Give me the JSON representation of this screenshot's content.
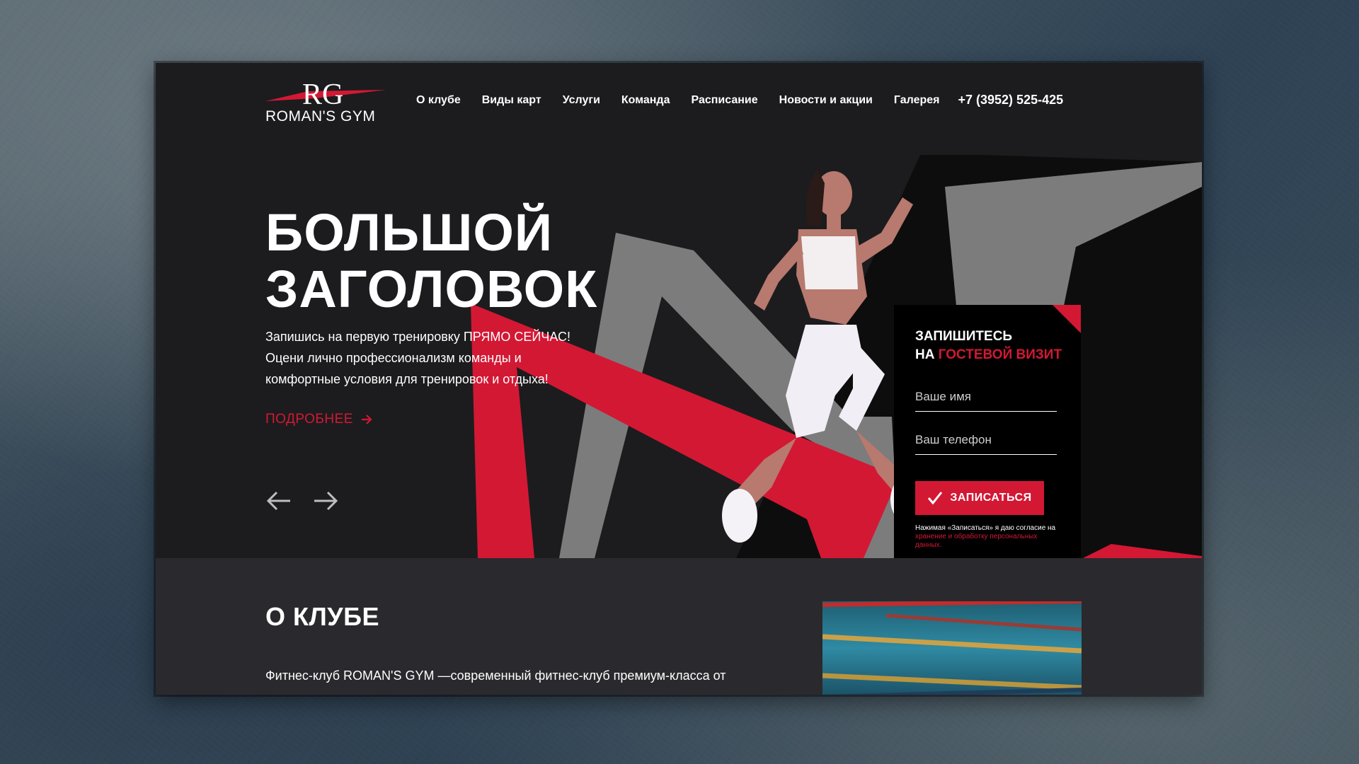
{
  "brand": {
    "logo_text": "ROMAN'S GYM"
  },
  "nav": {
    "items": [
      "О клубе",
      "Виды карт",
      "Услуги",
      "Команда",
      "Расписание",
      "Новости и акции",
      "Галерея"
    ],
    "phone": "+7 (3952) 525-425"
  },
  "hero": {
    "headline_line1": "БОЛЬШОЙ",
    "headline_line2": "ЗАГОЛОВОК",
    "lead": "Запишись на первую тренировку ПРЯМО СЕЙЧАС! Оцени лично профессионализм команды и комфортные условия для тренировок и отдыха!",
    "more_label": "ПОДРОБНЕЕ"
  },
  "form": {
    "title_line1": "ЗАПИШИТЕСЬ",
    "title_prefix": "НА ",
    "title_accent": "ГОСТЕВОЙ ВИЗИТ",
    "name_placeholder": "Ваше имя",
    "phone_placeholder": "Ваш телефон",
    "submit_label": "ЗАПИСАТЬСЯ",
    "consent_text": "Нажимая «Записаться» я даю согласие на ",
    "consent_link": "хранение и обработку персональных данных."
  },
  "about": {
    "title": "О КЛУБЕ",
    "text": "Фитнес-клуб ROMAN'S GYM —современный фитнес-клуб премиум-класса от"
  },
  "colors": {
    "accent": "#d31834",
    "dark": "#1c1c1e",
    "section": "#2a2a2e",
    "background": "#3c4d5a"
  }
}
